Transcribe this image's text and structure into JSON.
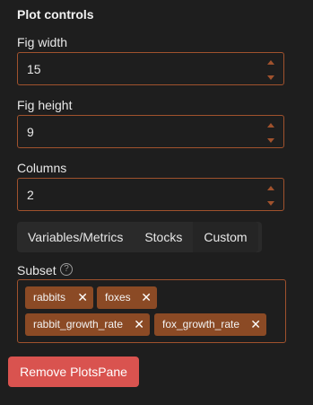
{
  "section": {
    "title": "Plot controls"
  },
  "fig_width": {
    "label": "Fig width",
    "value": "15"
  },
  "fig_height": {
    "label": "Fig height",
    "value": "9"
  },
  "columns": {
    "label": "Columns",
    "value": "2"
  },
  "tabs": [
    {
      "label": "Variables/Metrics"
    },
    {
      "label": "Stocks"
    },
    {
      "label": "Custom"
    }
  ],
  "subset": {
    "label": "Subset",
    "help_glyph": "?",
    "tags": [
      {
        "label": "rabbits"
      },
      {
        "label": "foxes"
      },
      {
        "label": "rabbit_growth_rate"
      },
      {
        "label": "fox_growth_rate"
      }
    ]
  },
  "remove_button": {
    "label": "Remove PlotsPane"
  },
  "colors": {
    "background": "#1e1e1e",
    "border_accent": "#a0522d",
    "tag_bg": "#8b4a25",
    "danger": "#d9534f"
  },
  "icons": {
    "spin_up": "caret-up-icon",
    "spin_down": "caret-down-icon",
    "tag_remove": "close-icon",
    "help": "help-icon"
  }
}
